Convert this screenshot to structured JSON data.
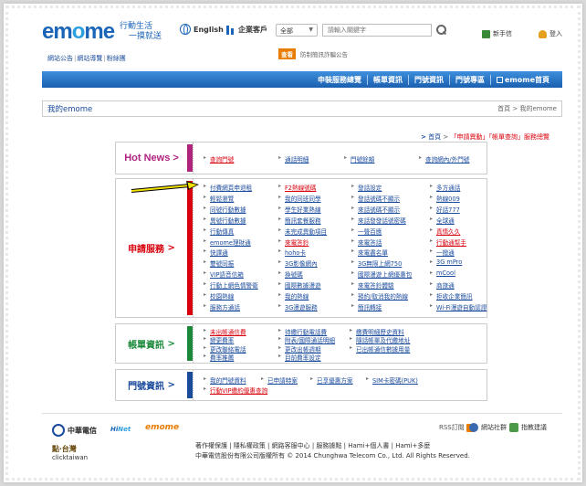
{
  "header": {
    "logo_text_a": "em",
    "logo_text_b": "o",
    "logo_text_c": "me",
    "tagline_1": "行動生活",
    "tagline_2": "一摸就送",
    "english_label": "English",
    "enterprise_label": "企業客戶",
    "category_select": "全部",
    "search_placeholder": "請輸入關鍵字",
    "new_mail_label": "新手信",
    "login_label": "登入",
    "sublinks": [
      "網站公告",
      "網站導覽",
      "粉絲團"
    ],
    "query_badge": "查看",
    "notice_text": "防制簡訊詐騙公告"
  },
  "navbar": {
    "items": [
      "申裝服務總覽",
      "帳單資訊",
      "門號資訊",
      "門號專區",
      "emome首頁"
    ]
  },
  "breadcrumb": {
    "title": "我的emome",
    "path": "首頁 > 我的emome"
  },
  "reflink": {
    "prefix": "首頁",
    "sep": " > ",
    "mid": "「申請異動」「帳單查詢」服務總覽"
  },
  "sections": {
    "hot": {
      "label": "Hot News",
      "links": [
        "查詢門號",
        "通話明細",
        "門號餘額",
        "查詢網內/外門號"
      ]
    },
    "apply": {
      "label": "申請服務",
      "links": [
        "付費網頁申退租",
        "F2熱線號碼",
        "發話設定",
        "多方通話",
        "輕鬆瀏覽",
        "我的同班同學",
        "發話號碼不顯示",
        "熱線009",
        "同號行動數據",
        "學生好業熱線",
        "來話號碼不顯示",
        "好話777",
        "異號行動數據",
        "簡訊套餐服務",
        "來話發發話號密碼",
        "全球通",
        "行動傳真",
        "未完成異動項目",
        "一聲百應",
        "真情久久",
        "emome理財通",
        "來電答鈴",
        "來電答話",
        "行動通幫手",
        "快譯通",
        "hoho卡",
        "來電盡名單",
        "一撥通",
        "雙號同振",
        "3G影像網內",
        "3G無限上網750",
        "3G mPro",
        "VIP語音信箱",
        "換號碼",
        "國際漫遊上網優惠包",
        "mCool",
        "行動上網色情警衛",
        "國際數據漫遊",
        "來電答鈴體驗",
        "商旅通",
        "校園熱線",
        "我的熱線",
        "預約/取消我的熱線",
        "拒收企業簡訊",
        "服務方通話",
        "3G漫遊服務",
        "簡訊轉接",
        "Wi-Fi漫遊自動認證"
      ]
    },
    "bill": {
      "label": "帳單資訊",
      "links": [
        "未出帳通信費",
        "待繳行動電話費",
        "繳費明細歷史資料",
        "變更費率",
        "附表/國際通話明細",
        "隨話帳單及代繳地址",
        "更改聯絡電話",
        "更改出帳週期",
        "已出帳通信數據用量",
        "費率推薦",
        "目前費率設定"
      ]
    },
    "num": {
      "label": "門號資訊",
      "links": [
        "我的門號資料",
        "已申請特案",
        "已享優惠方案",
        "SIM卡密碼(PUK)",
        "行動VIP繳約優惠查詢",
        "行動VIP繳約優惠查詢"
      ]
    }
  },
  "footer": {
    "cht_label": "中華電信",
    "hinet_a": "Hi",
    "hinet_b": "Net",
    "emome_label": "emome",
    "taiwan_1": "點‧台灣",
    "taiwan_2": "clicktaiwan",
    "rss_label": "RSS訂閱",
    "social_1": "網站社群",
    "social_2": "指教建議",
    "links": "著作權保護 | 隱私權政策 | 網路客服中心 | 服務據點 | Hami+個人書 | Hami+多麼",
    "copyright": "中華電信股份有限公司版權所有 © 2014 Chunghwa Telecom Co., Ltd. All Rights Reserved."
  },
  "colors": {
    "brand_blue": "#1b65b8",
    "hot_magenta": "#b0237f",
    "apply_red": "#d8000c",
    "bill_green": "#1a8a3a",
    "num_navy": "#1a4a9c",
    "annotation_arrow": "#f2e200"
  }
}
